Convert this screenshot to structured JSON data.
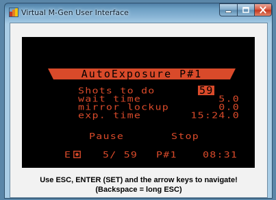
{
  "window": {
    "title": "Virtual M-Gen User Interface",
    "icons": {
      "app": "app-icon",
      "minimize": "minimize-icon",
      "maximize": "maximize-icon",
      "close": "close-icon"
    }
  },
  "lcd": {
    "title": "AutoExposure   P#1",
    "rows": [
      {
        "label": "Shots to do",
        "value": "59",
        "selected": true
      },
      {
        "label": "wait time",
        "value": "5.0"
      },
      {
        "label": "mirror lockup",
        "value": "0.0"
      },
      {
        "label": "exp. time",
        "value": "15:24.0"
      }
    ],
    "buttons": {
      "pause": "Pause",
      "stop": "Stop"
    },
    "status": {
      "mode": "E",
      "mode_icon": "record-icon",
      "progress": "5/ 59",
      "program": "P#1",
      "clock": "08:31"
    },
    "colors": {
      "foreground": "#d94a2a",
      "background": "#000000"
    }
  },
  "instructions": {
    "line1": "Use ESC, ENTER (SET) and the arrow keys to navigate!",
    "line2": "(Backspace = long ESC)"
  }
}
